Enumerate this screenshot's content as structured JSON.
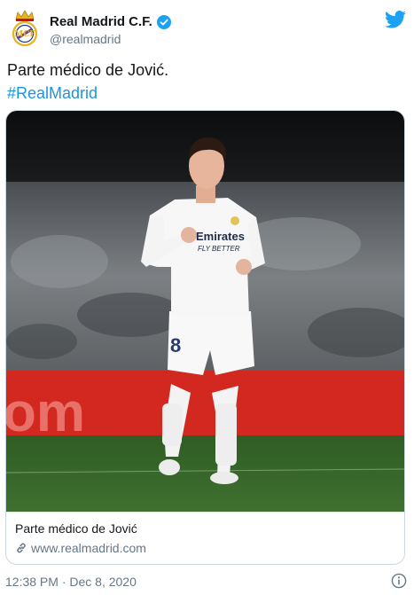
{
  "author": {
    "display_name": "Real Madrid C.F.",
    "handle": "@realmadrid",
    "verified": true,
    "avatar_icon": "real-madrid-crest"
  },
  "platform_icon": "twitter-bird-icon",
  "tweet": {
    "text": "Parte médico de Jović.",
    "hashtag": "#RealMadrid"
  },
  "card": {
    "title": "Parte médico de Jović",
    "link_icon": "link-icon",
    "domain": "www.realmadrid.com",
    "photo_text": {
      "sponsor": "Emirates",
      "tagline": "FLY BETTER",
      "number": "8",
      "board": "om"
    }
  },
  "footer": {
    "timestamp": "12:38 PM · Dec 8, 2020",
    "info_icon": "info-icon"
  },
  "colors": {
    "accent": "#1da1f2",
    "hashtag": "#1b95e0",
    "muted": "#657786",
    "border": "#ccd6dd"
  }
}
